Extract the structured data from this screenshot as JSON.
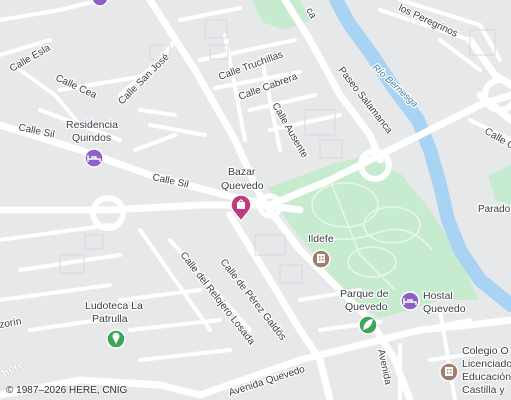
{
  "map": {
    "streets": {
      "esla": "Calle Esla",
      "cea": "Calle Cea",
      "san_jose": "Calle San José",
      "truchillas": "Calle Truchillas",
      "cabrera": "Calle Cabrera",
      "ausente": "Calle Ausente",
      "sil_1": "Calle Sil",
      "sil_2": "Calle Sil",
      "peregrinos": "los Peregrinos",
      "paseo": "Paseo Salamanca",
      "reloj": "Calle del Relojero Losada",
      "perez": "Calle de Pérez Galdós",
      "avenida": "Avenida Quevedo",
      "avenida_v": "Avenida",
      "zorin": "zorín",
      "calle_c": "Calle C",
      "ca_top": "ca"
    },
    "water": {
      "river": "Río Bernesga"
    },
    "places": {
      "parado": "Parado"
    },
    "pois": {
      "residencia": {
        "line1": "Residencia",
        "line2": "Quindos",
        "color": "#8d5fc7",
        "icon": "hotel-icon"
      },
      "bazar": {
        "line1": "Bazar",
        "line2": "Quevedo",
        "color": "#c23a7e",
        "icon": "shopping-bag-icon"
      },
      "ildefe": {
        "line1": "Ildefe",
        "color": "#a07d6d",
        "icon": "building-icon"
      },
      "parque": {
        "line1": "Parque de",
        "line2": "Quevedo",
        "color": "#3aa757",
        "icon": "leaf-icon"
      },
      "hostal": {
        "line1": "Hostal",
        "line2": "Quevedo",
        "color": "#8d5fc7",
        "icon": "hotel-icon"
      },
      "ludoteca": {
        "line1": "Ludoteca La",
        "line2": "Patrulla",
        "color": "#3aa757",
        "icon": "location-pin-icon"
      },
      "colegio": {
        "line1": "Colegio O",
        "line2": "Licenciado",
        "line3": "Educación",
        "line4": "Castilla y",
        "color": "#a07d6d",
        "icon": "building-icon"
      }
    },
    "colors": {
      "background": "#e6e8ea",
      "road": "#ffffff",
      "park": "#c7ebcf",
      "water": "#a9d3f2"
    }
  },
  "footer": {
    "copyright": "© 1987–2026 HERE, CNIG",
    "logo": "here"
  }
}
